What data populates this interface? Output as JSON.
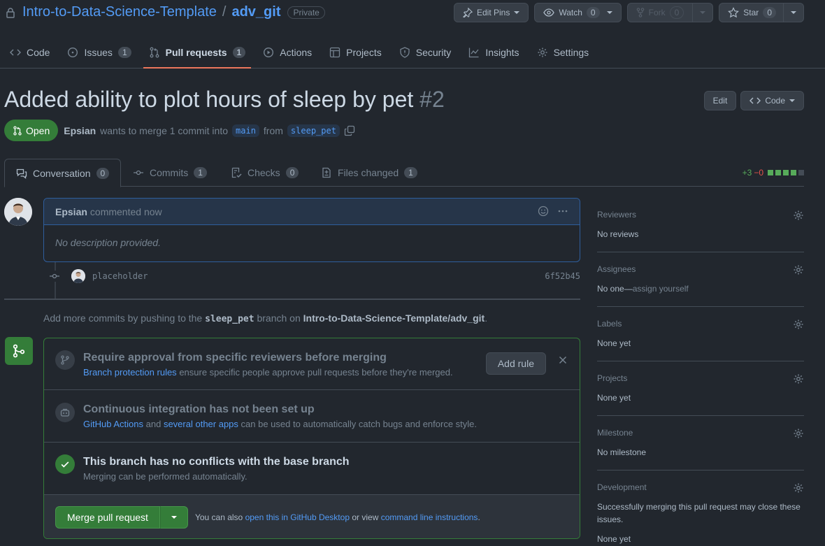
{
  "repo": {
    "owner": "Intro-to-Data-Science-Template",
    "separator": "/",
    "name": "adv_git",
    "visibility": "Private",
    "edit_pins": "Edit Pins",
    "watch": "Watch",
    "watch_count": "0",
    "fork": "Fork",
    "fork_count": "0",
    "star": "Star",
    "star_count": "0"
  },
  "nav": [
    {
      "label": "Code",
      "icon": "code-icon"
    },
    {
      "label": "Issues",
      "icon": "issue-icon",
      "count": "1"
    },
    {
      "label": "Pull requests",
      "icon": "pull-request-icon",
      "count": "1"
    },
    {
      "label": "Actions",
      "icon": "play-icon"
    },
    {
      "label": "Projects",
      "icon": "table-icon"
    },
    {
      "label": "Security",
      "icon": "shield-icon"
    },
    {
      "label": "Insights",
      "icon": "graph-icon"
    },
    {
      "label": "Settings",
      "icon": "gear-icon"
    }
  ],
  "pr": {
    "title": "Added ability to plot hours of sleep by pet",
    "number": "#2",
    "edit": "Edit",
    "code": "Code",
    "state": "Open",
    "author": "Epsian",
    "meta_text": "wants to merge 1 commit into",
    "base_branch": "main",
    "from_text": "from",
    "head_branch": "sleep_pet"
  },
  "tabs": [
    {
      "label": "Conversation",
      "count": "0"
    },
    {
      "label": "Commits",
      "count": "1"
    },
    {
      "label": "Checks",
      "count": "0"
    },
    {
      "label": "Files changed",
      "count": "1"
    }
  ],
  "diffstat": {
    "additions": "+3",
    "deletions": "−0"
  },
  "comment": {
    "author": "Epsian",
    "time": "commented now",
    "body": "No description provided."
  },
  "commit": {
    "message": "placeholder",
    "sha": "6f52b45"
  },
  "push_hint": {
    "prefix": "Add more commits by pushing to the",
    "branch": "sleep_pet",
    "middle": "branch on",
    "repo": "Intro-to-Data-Science-Template/adv_git",
    "suffix": "."
  },
  "merge_box": {
    "approval_title": "Require approval from specific reviewers before merging",
    "approval_link": "Branch protection rules",
    "approval_text": "ensure specific people approve pull requests before they're merged.",
    "add_rule": "Add rule",
    "ci_title": "Continuous integration has not been set up",
    "ci_link1": "GitHub Actions",
    "ci_and": "and",
    "ci_link2": "several other apps",
    "ci_text": "can be used to automatically catch bugs and enforce style.",
    "conflict_title": "This branch has no conflicts with the base branch",
    "conflict_sub": "Merging can be performed automatically.",
    "merge_button": "Merge pull request",
    "also_text": "You can also",
    "desktop_link": "open this in GitHub Desktop",
    "or_view": "or view",
    "cli_link": "command line instructions",
    "period": "."
  },
  "sidebar": {
    "reviewers": {
      "title": "Reviewers",
      "value": "No reviews"
    },
    "assignees": {
      "title": "Assignees",
      "value": "No one—",
      "link": "assign yourself"
    },
    "labels": {
      "title": "Labels",
      "value": "None yet"
    },
    "projects": {
      "title": "Projects",
      "value": "None yet"
    },
    "milestone": {
      "title": "Milestone",
      "value": "No milestone"
    },
    "development": {
      "title": "Development",
      "value": "Successfully merging this pull request may close these issues.",
      "value2": "None yet"
    }
  }
}
